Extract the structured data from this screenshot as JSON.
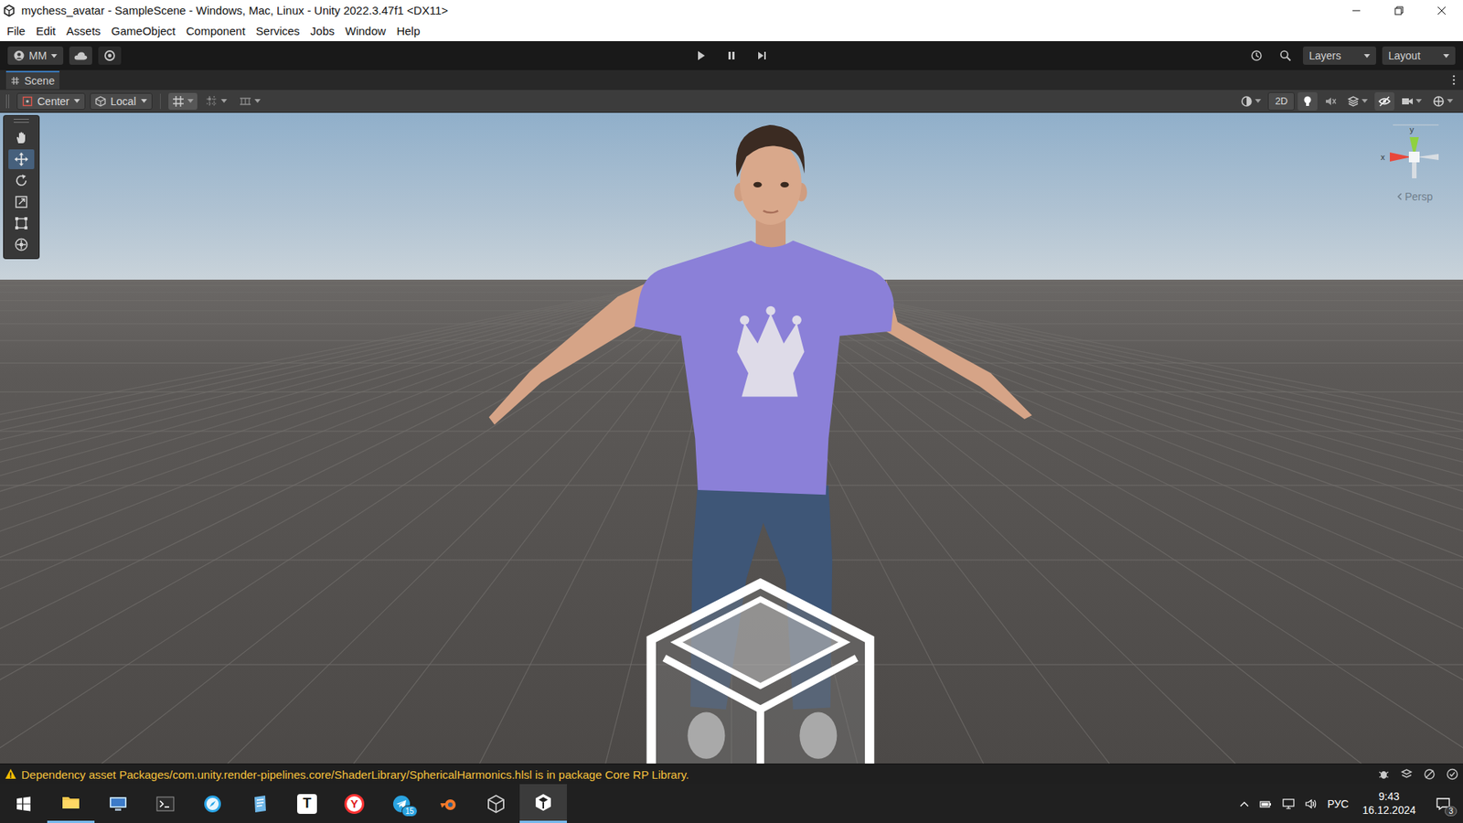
{
  "window": {
    "title": "mychess_avatar - SampleScene - Windows, Mac, Linux - Unity 2022.3.47f1 <DX11>"
  },
  "menu": [
    "File",
    "Edit",
    "Assets",
    "GameObject",
    "Component",
    "Services",
    "Jobs",
    "Window",
    "Help"
  ],
  "toolbar": {
    "account": "MM",
    "playback": [
      {
        "kind": "play",
        "selected": false
      },
      {
        "kind": "pause",
        "selected": false
      },
      {
        "kind": "step",
        "selected": false
      }
    ],
    "layers": "Layers",
    "layout": "Layout"
  },
  "scene_tab": {
    "label": "Scene",
    "selected": true
  },
  "scene_toolbar": {
    "pivot": "Center",
    "space": "Local",
    "grid_tools": [
      {
        "kind": "grid",
        "on": true
      },
      {
        "kind": "snap",
        "on": false
      },
      {
        "kind": "increment",
        "on": false
      }
    ],
    "toggles": [
      {
        "kind": "shading",
        "on": false
      },
      {
        "kind": "2d",
        "label": "2D",
        "on": false
      },
      {
        "kind": "lighting",
        "on": true
      },
      {
        "kind": "audio",
        "on": false
      },
      {
        "kind": "effects",
        "on": false
      },
      {
        "kind": "visibility",
        "on": true
      },
      {
        "kind": "camera",
        "on": false
      },
      {
        "kind": "gizmos",
        "on": false
      }
    ]
  },
  "tools": [
    {
      "kind": "hand",
      "selected": false
    },
    {
      "kind": "move",
      "selected": true
    },
    {
      "kind": "rotate",
      "selected": false
    },
    {
      "kind": "scale",
      "selected": false
    },
    {
      "kind": "rect",
      "selected": false
    },
    {
      "kind": "transform",
      "selected": false
    }
  ],
  "gizmo": {
    "axes": [
      {
        "label": "y",
        "color": "#8fd13f"
      },
      {
        "label": "x",
        "color": "#e8473b"
      }
    ],
    "projection": "Persp"
  },
  "status_bar": {
    "warning": "Dependency asset Packages/com.unity.render-pipelines.core/ShaderLibrary/SphericalHarmonics.hlsl is in package Core RP Library."
  },
  "taskbar": {
    "apps": [
      {
        "kind": "explorer",
        "open": true,
        "selected": false
      },
      {
        "kind": "monitor",
        "open": false,
        "selected": false
      },
      {
        "kind": "terminal",
        "open": false,
        "selected": false
      },
      {
        "kind": "compass",
        "open": false,
        "selected": false
      },
      {
        "kind": "notes",
        "open": false,
        "selected": false
      },
      {
        "kind": "letter",
        "glyph": "T",
        "open": false,
        "selected": false
      },
      {
        "kind": "yandex",
        "glyph": "Y",
        "open": false,
        "selected": false
      },
      {
        "kind": "telegram",
        "badge": "15",
        "open": false,
        "selected": false
      },
      {
        "kind": "blender",
        "open": false,
        "selected": false
      },
      {
        "kind": "unityhub",
        "open": false,
        "selected": false
      },
      {
        "kind": "unity",
        "open": true,
        "selected": true
      }
    ],
    "language": "РУС",
    "time": "9:43",
    "date": "16.12.2024",
    "notifications": "3"
  }
}
